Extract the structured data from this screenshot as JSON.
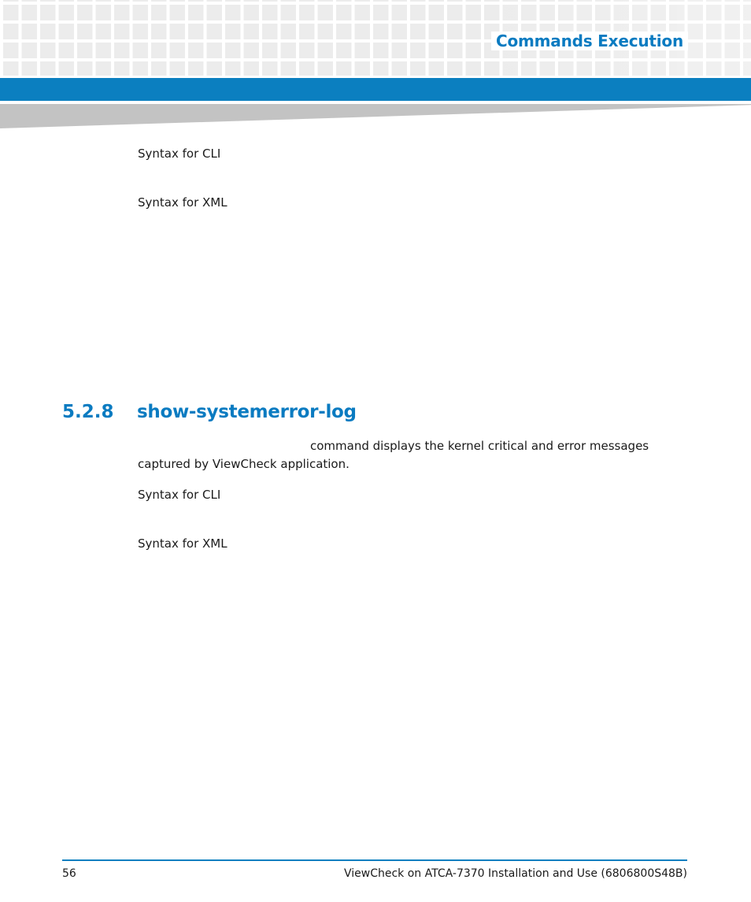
{
  "header": {
    "title": "Commands Execution"
  },
  "top_section": {
    "syntax_cli_label": "Syntax for CLI",
    "syntax_xml_label": "Syntax for XML"
  },
  "section": {
    "number": "5.2.8",
    "title": "show-systemerror-log",
    "description_line1": "command displays the kernel critical and error messages",
    "description_line2": "captured by ViewCheck application.",
    "syntax_cli_label": "Syntax for CLI",
    "syntax_xml_label": "Syntax for XML"
  },
  "footer": {
    "page_number": "56",
    "document_title": "ViewCheck on ATCA-7370 Installation and Use (6806800S48B)"
  },
  "colors": {
    "accent_blue": "#0b7fc0",
    "heading_blue": "#0a7bc1",
    "wedge_gray": "#c3c3c3"
  }
}
